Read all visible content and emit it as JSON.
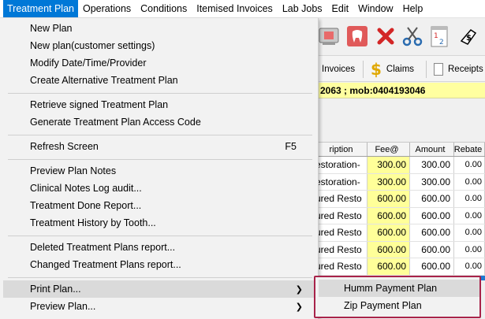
{
  "menubar": {
    "items": [
      {
        "label": "Treatment Plan",
        "active": true
      },
      {
        "label": "Operations"
      },
      {
        "label": "Conditions"
      },
      {
        "label": "Itemised Invoices"
      },
      {
        "label": "Lab Jobs"
      },
      {
        "label": "Edit"
      },
      {
        "label": "Window"
      },
      {
        "label": "Help"
      }
    ]
  },
  "toolbar": {
    "icons": [
      "x-ray-icon",
      "tooth-icon",
      "delete-x-icon",
      "scissors-icon",
      "calendar-icon",
      "dollar-icon"
    ]
  },
  "tabs": {
    "invoices": "Invoices",
    "claims": "Claims",
    "receipts": "Receipts"
  },
  "patient_info": "2063 ; mob:0404193046",
  "grid": {
    "headers": [
      "ription",
      "Fee@",
      "Amount",
      "Rebate"
    ],
    "rows": [
      [
        "estoration-",
        "300.00",
        "300.00",
        "0.00"
      ],
      [
        "estoration-",
        "300.00",
        "300.00",
        "0.00"
      ],
      [
        "ured Resto",
        "600.00",
        "600.00",
        "0.00"
      ],
      [
        "ured Resto",
        "600.00",
        "600.00",
        "0.00"
      ],
      [
        "ured Resto",
        "600.00",
        "600.00",
        "0.00"
      ],
      [
        "ured Resto",
        "600.00",
        "600.00",
        "0.00"
      ],
      [
        "ured Resto",
        "600.00",
        "600.00",
        "0.00"
      ]
    ]
  },
  "menu": {
    "new_plan": "New Plan",
    "new_plan_customer": "New plan(customer settings)",
    "modify": "Modify Date/Time/Provider",
    "create_alt": "Create Alternative Treatment Plan",
    "retrieve_signed": "Retrieve signed Treatment Plan",
    "generate_code": "Generate Treatment Plan Access Code",
    "refresh": "Refresh Screen",
    "refresh_shortcut": "F5",
    "preview_notes": "Preview Plan Notes",
    "clinical_audit": "Clinical Notes Log audit...",
    "done_report": "Treatment Done Report...",
    "history_tooth": "Treatment History by Tooth...",
    "deleted_report": "Deleted Treatment Plans report...",
    "changed_report": "Changed Treatment Plans report...",
    "print_plan": "Print Plan...",
    "preview_plan": "Preview Plan..."
  },
  "submenu": {
    "humm": "Humm Payment Plan",
    "zip": "Zip Payment Plan"
  },
  "colors": {
    "menu_active": "#0078d7",
    "highlight_border": "#a8234a",
    "info_bar": "#ffffa0",
    "fee_cell": "#ffff99"
  }
}
